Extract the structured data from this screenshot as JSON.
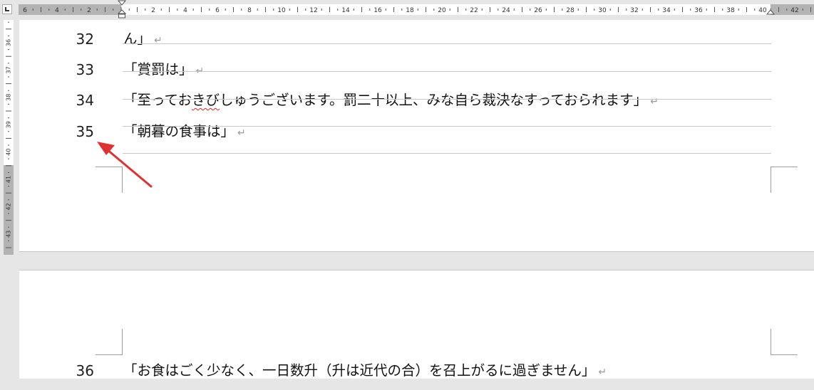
{
  "horizontal_ruler": {
    "labels": [
      "6",
      "4",
      "2",
      "2",
      "4",
      "6",
      "8",
      "10",
      "12",
      "14",
      "16",
      "18",
      "20",
      "22",
      "24",
      "26",
      "28",
      "30",
      "32",
      "34",
      "36",
      "38",
      "40",
      "42"
    ]
  },
  "vertical_ruler": {
    "labels": [
      "36",
      "37",
      "38",
      "39",
      "40",
      "41",
      "42",
      "43"
    ]
  },
  "page1": {
    "lines": [
      {
        "number": "32",
        "text": "ん」"
      },
      {
        "number": "33",
        "text": "「賞罰は」"
      },
      {
        "number": "34",
        "text_before": "「至ってお",
        "text_flagged": "きび",
        "text_after": "しゅうございます。罰二十以上、みな自ら裁決なすっておられます」"
      },
      {
        "number": "35",
        "text": "「朝暮の食事は」"
      }
    ]
  },
  "page2": {
    "lines": [
      {
        "number": "36",
        "text": "「お食はごく少なく、一日数升（升は近代の合）を召上がるに過ぎません」"
      }
    ]
  },
  "paragraph_mark": "↵",
  "colors": {
    "annotation_arrow": "#e03131",
    "spelling_squiggle": "#e02020",
    "ruler_margin": "#b3b3b3"
  },
  "icons": [
    "tab-stop-selector-icon",
    "first-line-indent-icon",
    "hanging-indent-icon",
    "right-indent-icon",
    "paragraph-mark-icon",
    "annotation-arrow-icon"
  ]
}
